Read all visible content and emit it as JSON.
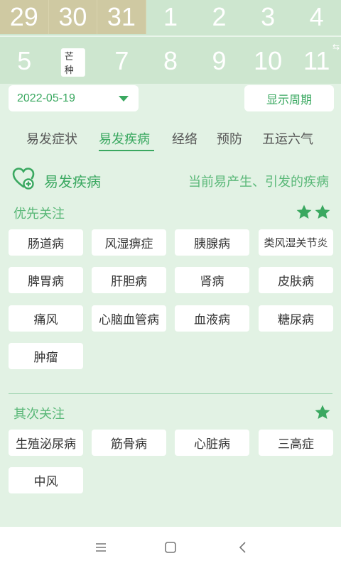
{
  "calendar": {
    "prev_days": [
      "29",
      "30",
      "31"
    ],
    "row1_days": [
      "1",
      "2",
      "3",
      "4"
    ],
    "row2_days": [
      "5",
      "6",
      "7",
      "8",
      "9",
      "10",
      "11"
    ],
    "solar_term": "芒种"
  },
  "controls": {
    "date_value": "2022-05-19",
    "period_button": "显示周期"
  },
  "tabs": [
    {
      "label": "易发症状",
      "active": false
    },
    {
      "label": "易发疾病",
      "active": true
    },
    {
      "label": "经络",
      "active": false
    },
    {
      "label": "预防",
      "active": false
    },
    {
      "label": "五运六气",
      "active": false
    }
  ],
  "section": {
    "title": "易发疾病",
    "subtitle": "当前易产生、引发的疾病"
  },
  "priority": {
    "title": "优先关注",
    "stars": 2,
    "items": [
      "肠道病",
      "风湿痹症",
      "胰腺病",
      "类风湿关节炎",
      "脾胃病",
      "肝胆病",
      "肾病",
      "皮肤病",
      "痛风",
      "心脑血管病",
      "血液病",
      "糖尿病",
      "肿瘤"
    ]
  },
  "secondary": {
    "title": "其次关注",
    "stars": 1,
    "items": [
      "生殖泌尿病",
      "筋骨病",
      "心脏病",
      "三高症",
      "中风"
    ]
  },
  "colors": {
    "accent": "#3aa860",
    "background": "#e2f2e4",
    "calendar_bg": "#cde6cf",
    "prev_month_bg": "#cfc9a2"
  },
  "navbar": {
    "icons": [
      "menu-icon",
      "home-square-icon",
      "back-icon"
    ]
  }
}
